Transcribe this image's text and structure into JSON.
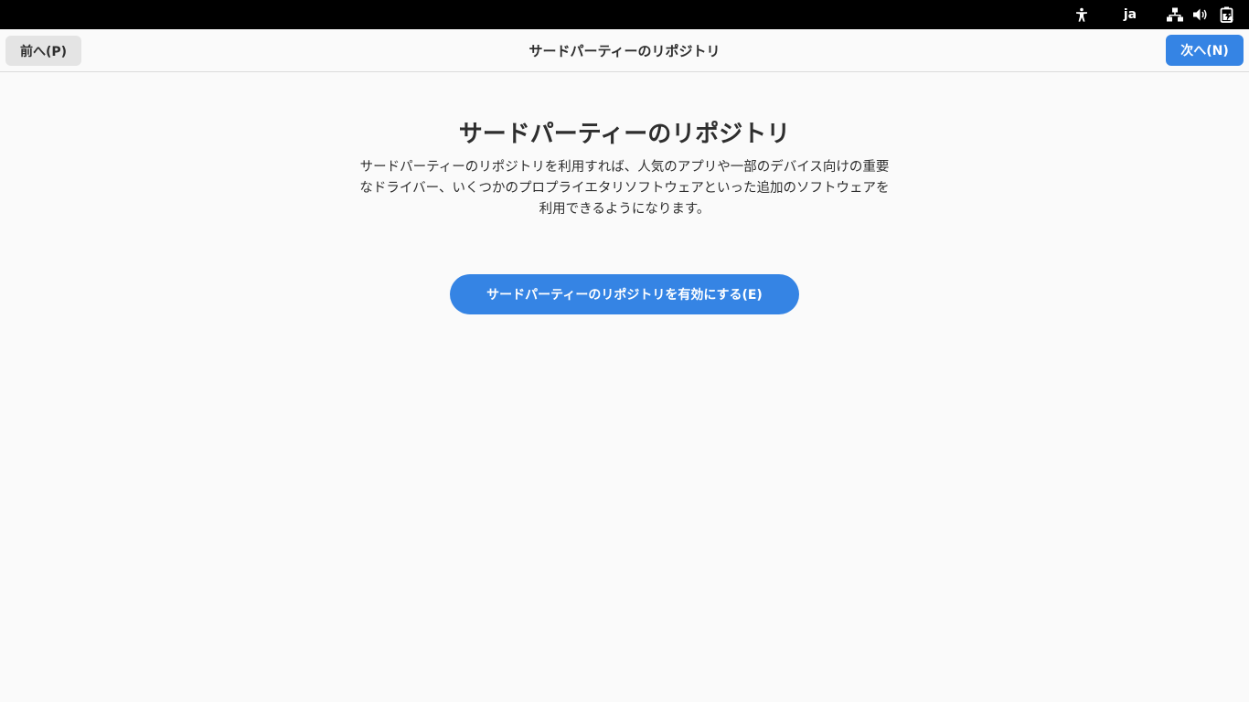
{
  "topbar": {
    "accessibility_icon": "accessibility-icon",
    "language": "ja",
    "network_icon": "network-wired-icon",
    "volume_icon": "volume-icon",
    "battery_icon": "battery-charging-icon"
  },
  "header": {
    "back_label": "前へ(P)",
    "title": "サードパーティーのリポジトリ",
    "next_label": "次へ(N)"
  },
  "main": {
    "heading": "サードパーティーのリポジトリ",
    "description": "サードパーティーのリポジトリを利用すれば、人気のアプリや一部のデバイス向けの重要なドライバー、いくつかのプロプライエタリソフトウェアといった追加のソフトウェアを利用できるようになります。",
    "enable_button_label": "サードパーティーのリポジトリを有効にする(E)"
  },
  "colors": {
    "accent": "#3584e4",
    "topbar_bg": "#000000",
    "window_bg": "#fafafa"
  }
}
